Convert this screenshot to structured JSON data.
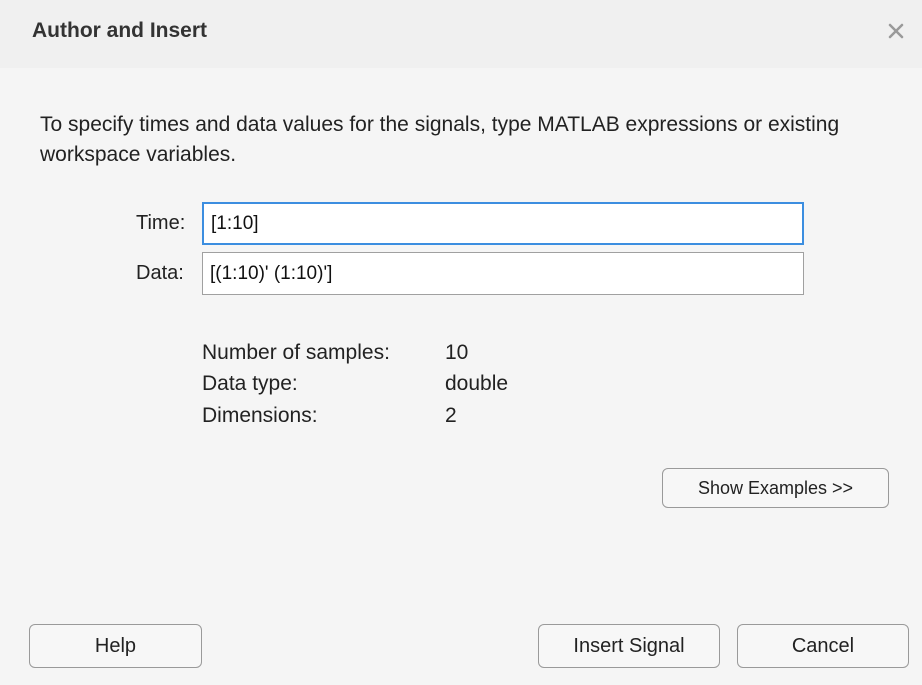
{
  "dialog": {
    "title": "Author and Insert",
    "close_icon": "close-icon"
  },
  "description": "To specify times and data values for the signals, type MATLAB expressions or existing workspace variables.",
  "fields": {
    "time": {
      "label": "Time:",
      "value": "[1:10]"
    },
    "data": {
      "label": "Data:",
      "value": "[(1:10)' (1:10)']"
    }
  },
  "info": {
    "samples_label": "Number of samples:",
    "samples_value": "10",
    "type_label": "Data type:",
    "type_value": "double",
    "dims_label": "Dimensions:",
    "dims_value": "2"
  },
  "buttons": {
    "show_examples": "Show Examples >>",
    "help": "Help",
    "insert_signal": "Insert Signal",
    "cancel": "Cancel"
  },
  "colors": {
    "focus_border": "#3c8ee0",
    "background": "#f5f5f5"
  }
}
